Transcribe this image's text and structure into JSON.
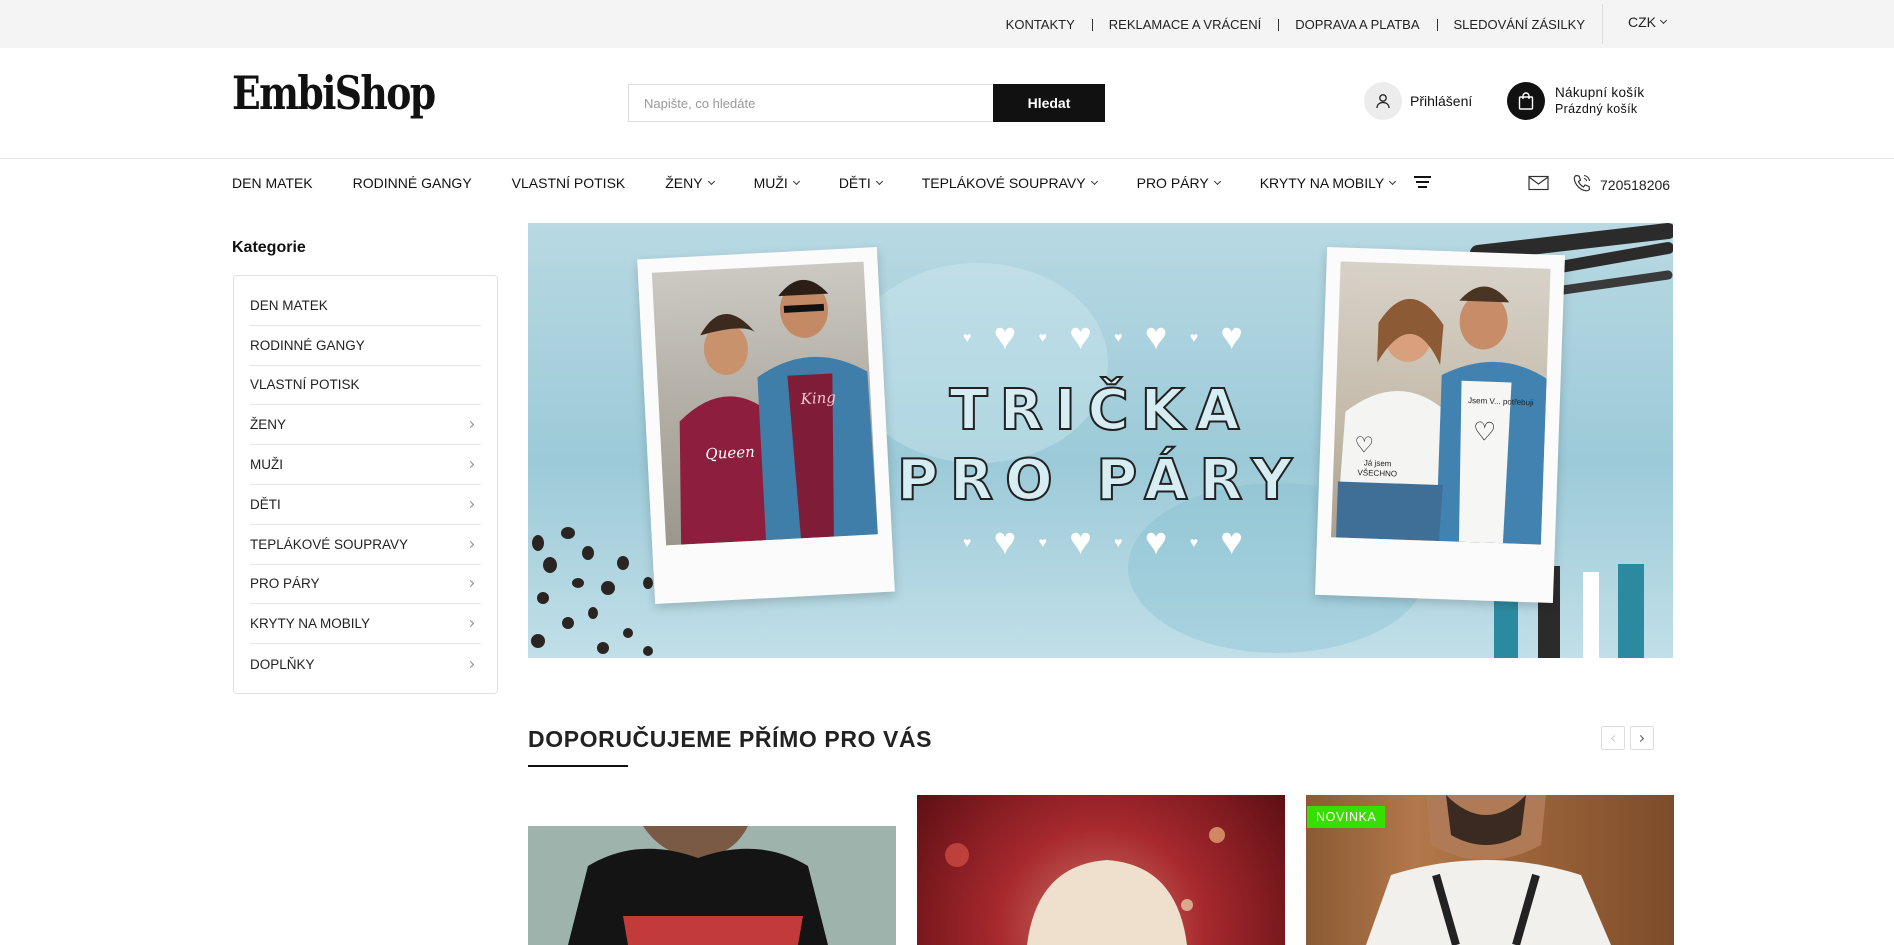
{
  "topbar": {
    "links": [
      "KONTAKTY",
      "REKLAMACE A VRÁCENÍ",
      "DOPRAVA A PLATBA",
      "SLEDOVÁNÍ ZÁSILKY"
    ],
    "currency": "CZK"
  },
  "header": {
    "logo_text": "EmbiShop",
    "search_placeholder": "Napište, co hledáte",
    "search_button": "Hledat",
    "login_label": "Přihlášení",
    "cart_title": "Nákupní košík",
    "cart_status": "Prázdný košík",
    "icons": {
      "login": "user-icon",
      "cart": "shopping-bag-icon"
    }
  },
  "nav": {
    "items": [
      {
        "label": "DEN MATEK"
      },
      {
        "label": "RODINNÉ GANGY"
      },
      {
        "label": "VLASTNÍ POTISK"
      },
      {
        "label": "ŽENY"
      },
      {
        "label": "MUŽI"
      },
      {
        "label": "DĚTI"
      },
      {
        "label": "TEPLÁKOVÉ SOUPRAVY"
      },
      {
        "label": "PRO PÁRY"
      },
      {
        "label": "KRYTY NA MOBILY"
      }
    ],
    "phone": "720518206",
    "icons": {
      "menu": "menu-icon",
      "mail": "mail-icon",
      "phone": "phone-icon"
    }
  },
  "sidebar": {
    "title": "Kategorie",
    "items": [
      {
        "label": "DEN MATEK"
      },
      {
        "label": "RODINNÉ GANGY"
      },
      {
        "label": "VLASTNÍ POTISK"
      },
      {
        "label": "ŽENY"
      },
      {
        "label": "MUŽI"
      },
      {
        "label": "DĚTI"
      },
      {
        "label": "TEPLÁKOVÉ SOUPRAVY"
      },
      {
        "label": "PRO PÁRY"
      },
      {
        "label": "KRYTY NA MOBILY"
      },
      {
        "label": "DOPLŇKY"
      }
    ]
  },
  "banner": {
    "line1": "TRIČKA",
    "line2": "PRO PÁRY",
    "left_shirt_her": "Queen",
    "left_shirt_his": "King",
    "right_shirt_her": "Já jsem VŠECHNO",
    "right_shirt_his": "Jsem V... potřebuji",
    "colors": {
      "background": "#a9d2de",
      "accent": "#2c8aa0"
    }
  },
  "recommend": {
    "title": "DOPORUČUJEME PŘÍMO PRO VÁS",
    "badge": "NOVINKA"
  },
  "colors": {
    "primary": "#111111",
    "badge": "#35e000",
    "topbar_bg": "#f4f4f4"
  }
}
